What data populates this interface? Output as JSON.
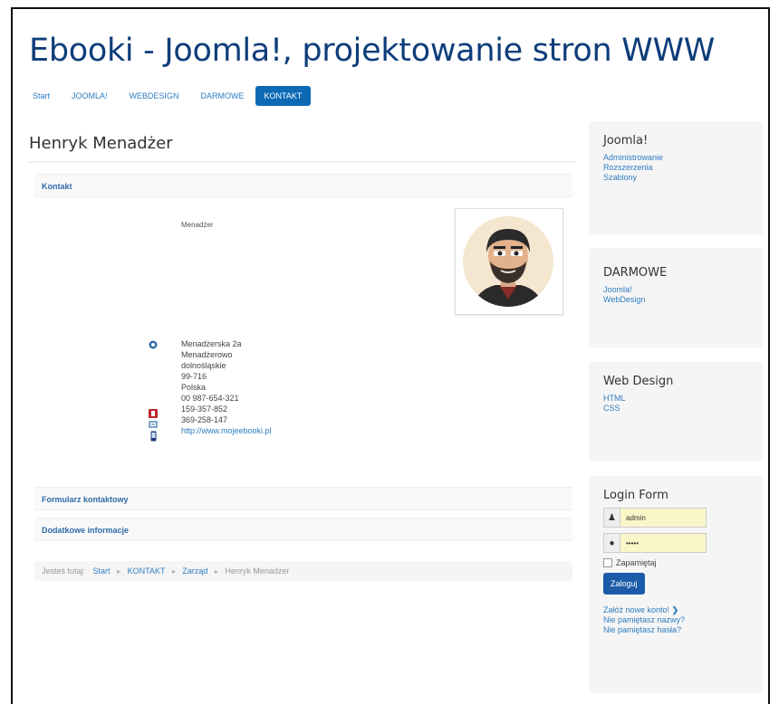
{
  "site": {
    "title": "Ebooki - Joomla!, projektowanie stron WWW"
  },
  "nav": [
    {
      "label": "Start"
    },
    {
      "label": "JOOMLA!"
    },
    {
      "label": "WEBDESIGN"
    },
    {
      "label": "DARMOWE"
    },
    {
      "label": "KONTAKT"
    }
  ],
  "contact": {
    "name": "Henryk Menadżer",
    "section_contact": "Kontakt",
    "position": "Menadżer",
    "address": {
      "street": "Menadżerska 2a",
      "city": "Menadżerowo",
      "region": "dolnośląskie",
      "postcode": "99-716",
      "country": "Polska",
      "phone": "00 987-654-321",
      "fax": "159-357-852",
      "mobile": "369-258-147",
      "website": "http://www.mojeebooki.pl"
    },
    "section_form": "Formularz kontaktowy",
    "section_more": "Dodatkowe informacje"
  },
  "breadcrumb": {
    "prefix": "Jesteś tutaj:",
    "items": [
      "Start",
      "KONTAKT",
      "Zarząd",
      "Henryk Menadżer"
    ]
  },
  "sidebar": {
    "joomla": {
      "title": "Joomla!",
      "links": [
        "Administrowanie",
        "Rozszerzenia",
        "Szablony"
      ]
    },
    "darmowe": {
      "title": "DARMOWE",
      "links": [
        "Joomla!",
        "WebDesign"
      ]
    },
    "webdesign": {
      "title": "Web Design",
      "links": [
        "HTML",
        "CSS"
      ]
    },
    "login": {
      "title": "Login Form",
      "username_value": "admin",
      "password_value": "•••••",
      "remember_label": "Zapamiętaj",
      "submit_label": "Zaloguj",
      "links": [
        "Załóż nowe konto!",
        "Nie pamiętasz nazwy?",
        "Nie pamiętasz hasła?"
      ]
    }
  }
}
